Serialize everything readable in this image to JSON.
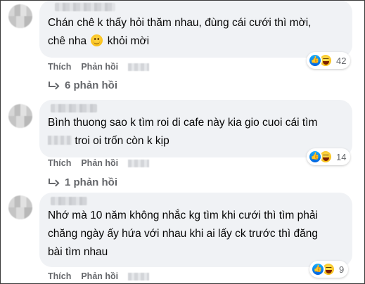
{
  "comments": [
    {
      "text": "Chán chê k thấy hỏi thăm nhau, đùng cái cưới thì mời,",
      "text_line2_pre": "chê nha",
      "text_line2_post": "khỏi mời",
      "reaction_count": "42",
      "like_label": "Thích",
      "reply_label": "Phản hồi",
      "replies_label": "6 phản hồi"
    },
    {
      "text": "Bình thuong sao k tìm roi di cafe này kia gio cuoi cái tìm",
      "text_line2_post": "troi oi trốn còn k kịp",
      "reaction_count": "14",
      "like_label": "Thích",
      "reply_label": "Phản hồi",
      "replies_label": "1 phản hồi"
    },
    {
      "text": "Nhớ mà 10 năm không nhắc kg tìm khi cưới thì tìm phải",
      "text_line2": "chăng ngày ấy hứa với nhau khi ai lấy ck trước thì đăng",
      "text_line3": "bài tìm nhau",
      "reaction_count": "9",
      "like_label": "Thích",
      "reply_label": "Phản hồi"
    }
  ],
  "icons": {
    "like": "like-reaction-icon",
    "haha": "haha-reaction-icon",
    "smile": "smiling-face-emoji",
    "reply": "reply-arrow-icon"
  },
  "colors": {
    "bubble": "#f0f2f5",
    "secondary_text": "#65676b",
    "like_blue": "#0062df",
    "haha_yellow": "#f5b400"
  }
}
